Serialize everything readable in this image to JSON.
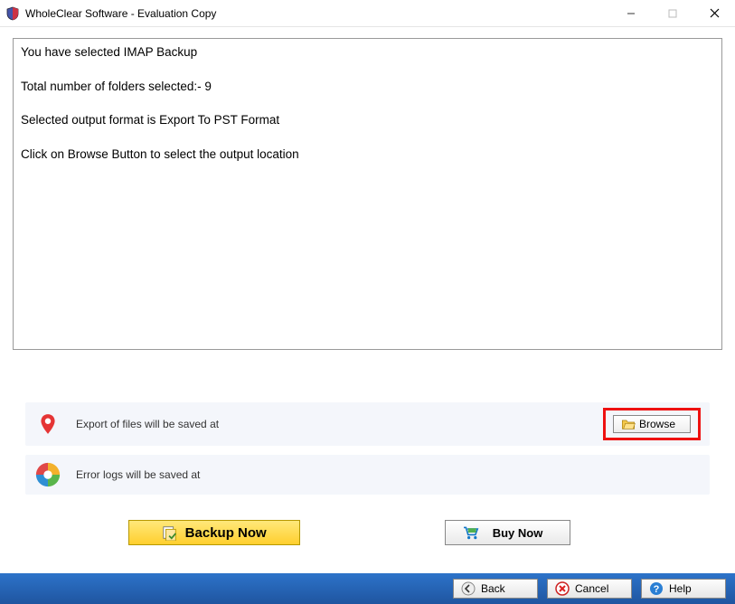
{
  "window": {
    "title": "WholeClear Software - Evaluation Copy"
  },
  "info": {
    "line1": "You have selected IMAP Backup",
    "line2": "Total number of folders selected:- 9",
    "line3": "Selected output format is Export To PST Format",
    "line4": "Click on Browse Button to select the output location"
  },
  "paths": {
    "export_label": "Export of files will be saved at",
    "error_label": "Error logs will be saved at",
    "browse_label": "Browse"
  },
  "actions": {
    "backup_label": "Backup Now",
    "buy_label": "Buy Now"
  },
  "nav": {
    "back_label": "Back",
    "cancel_label": "Cancel",
    "help_label": "Help"
  }
}
